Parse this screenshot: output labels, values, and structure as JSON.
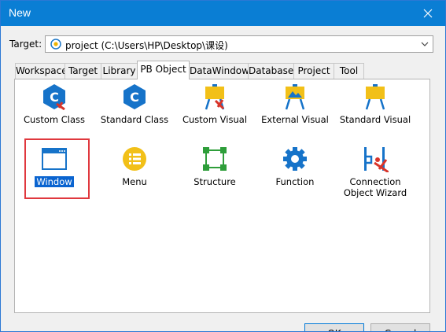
{
  "window": {
    "title": "New"
  },
  "target": {
    "label": "Target:",
    "value": "project (C:\\Users\\HP\\Desktop\\课设)"
  },
  "tabs": [
    {
      "label": "Workspace",
      "active": false
    },
    {
      "label": "Target",
      "active": false
    },
    {
      "label": "Library",
      "active": false
    },
    {
      "label": "PB Object",
      "active": true
    },
    {
      "label": "DataWindow",
      "active": false
    },
    {
      "label": "Database",
      "active": false
    },
    {
      "label": "Project",
      "active": false
    },
    {
      "label": "Tool",
      "active": false
    }
  ],
  "items": [
    {
      "label": "Custom Class",
      "icon": "custom-class-icon"
    },
    {
      "label": "Standard Class",
      "icon": "standard-class-icon"
    },
    {
      "label": "Custom Visual",
      "icon": "custom-visual-icon"
    },
    {
      "label": "External Visual",
      "icon": "external-visual-icon"
    },
    {
      "label": "Standard Visual",
      "icon": "standard-visual-icon"
    },
    {
      "label": "Window",
      "icon": "window-icon",
      "selected": true
    },
    {
      "label": "Menu",
      "icon": "menu-icon"
    },
    {
      "label": "Structure",
      "icon": "structure-icon"
    },
    {
      "label": "Function",
      "icon": "function-icon"
    },
    {
      "label": "Connection Object Wizard",
      "icon": "connection-wizard-icon"
    }
  ],
  "buttons": {
    "ok": "OK",
    "cancel": "Cancel"
  },
  "colors": {
    "titlebar": "#0a7ed4",
    "selection_outline": "#e0383e",
    "selection_fill": "#0a64d0",
    "icon_blue": "#1673c9",
    "icon_yellow": "#f2c018",
    "icon_green": "#2e9e3a",
    "icon_red": "#d8342a"
  }
}
